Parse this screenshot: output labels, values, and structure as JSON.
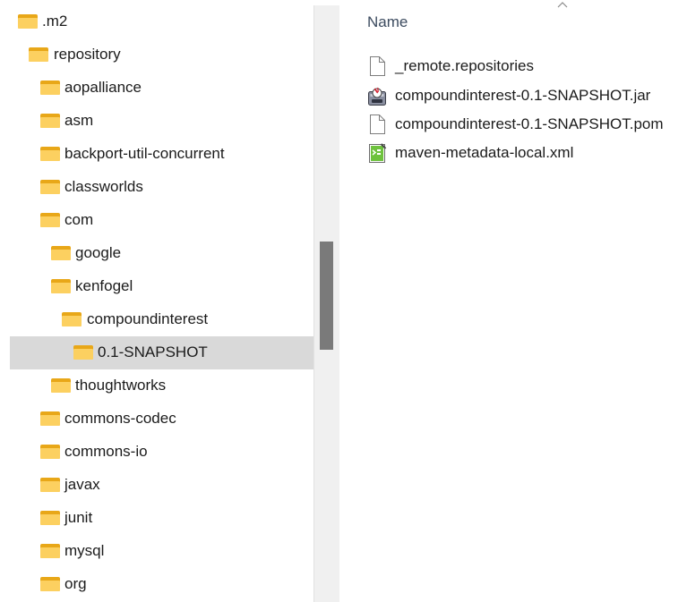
{
  "tree": {
    "items": [
      {
        "label": ".m2"
      },
      {
        "label": "repository"
      },
      {
        "label": "aopalliance"
      },
      {
        "label": "asm"
      },
      {
        "label": "backport-util-concurrent"
      },
      {
        "label": "classworlds"
      },
      {
        "label": "com"
      },
      {
        "label": "google"
      },
      {
        "label": "kenfogel"
      },
      {
        "label": "compoundinterest"
      },
      {
        "label": "0.1-SNAPSHOT",
        "selected": true
      },
      {
        "label": "thoughtworks"
      },
      {
        "label": "commons-codec"
      },
      {
        "label": "commons-io"
      },
      {
        "label": "javax"
      },
      {
        "label": "junit"
      },
      {
        "label": "mysql"
      },
      {
        "label": "org"
      }
    ]
  },
  "files": {
    "column_header": "Name",
    "rows": [
      {
        "name": "_remote.repositories",
        "icon": "blank-file-icon"
      },
      {
        "name": "compoundinterest-0.1-SNAPSHOT.jar",
        "icon": "java-jar-icon"
      },
      {
        "name": "compoundinterest-0.1-SNAPSHOT.pom",
        "icon": "blank-file-icon"
      },
      {
        "name": "maven-metadata-local.xml",
        "icon": "xml-file-icon"
      }
    ]
  },
  "colors": {
    "selection": "#d9d9d9",
    "folder": "#fcd060",
    "header_text": "#3c4b5f"
  }
}
